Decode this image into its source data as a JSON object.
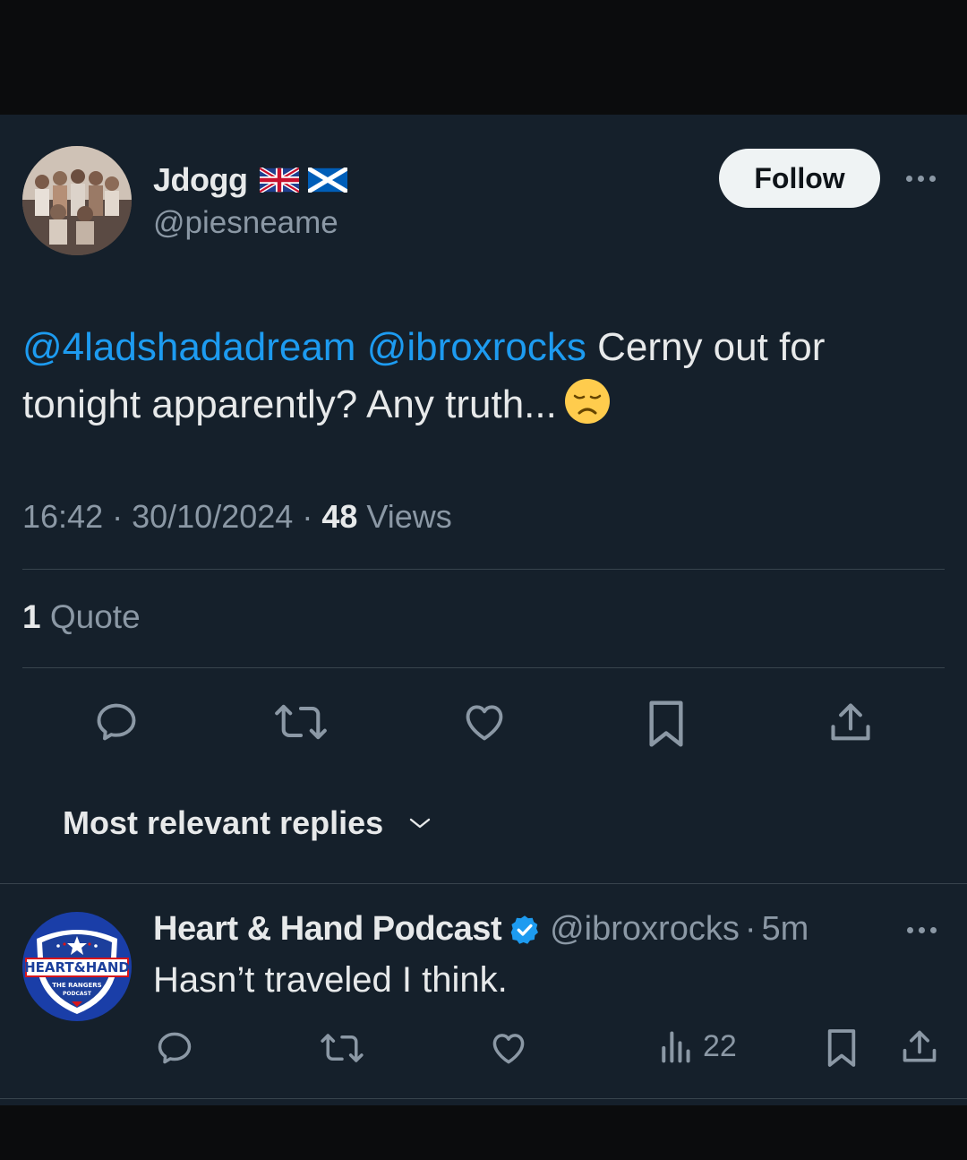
{
  "tweet": {
    "display_name": "Jdogg",
    "flags": [
      "uk-flag-icon",
      "scotland-flag-icon"
    ],
    "handle": "@piesneame",
    "follow_label": "Follow",
    "mention1": "@4ladshadadream",
    "mention2": "@ibroxrocks",
    "text_part1": " Cerny out for tonight apparently? Any truth...",
    "emoji": "disappointed-face-emoji",
    "time": "16:42",
    "date": "30/10/2024",
    "views_count": "48",
    "views_label": " Views",
    "quote_count": "1",
    "quote_label": " Quote"
  },
  "actions": [
    "reply-icon",
    "retweet-icon",
    "like-icon",
    "bookmark-icon",
    "share-icon"
  ],
  "sort": {
    "label": "Most relevant replies"
  },
  "reply": {
    "name": "Heart & Hand Podcast",
    "handle": "@ibroxrocks",
    "separator": "·",
    "time": "5m",
    "text": "Hasn’t traveled I think.",
    "views": "22",
    "avatar_text_main": "HEART&HAND",
    "avatar_text_sub1": "THE RANGERS",
    "avatar_text_sub2": "PODCAST"
  },
  "colors": {
    "background": "#15202b",
    "accent": "#1d9bf0",
    "text": "#e7e9ea",
    "muted": "#8b98a5",
    "divider": "#38444d"
  }
}
